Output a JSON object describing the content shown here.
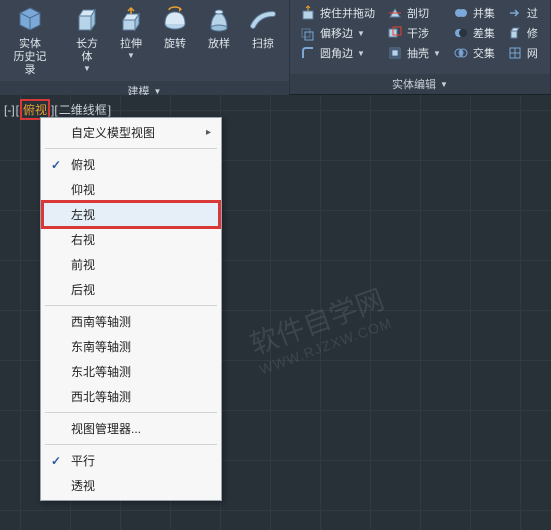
{
  "ribbon": {
    "panel1": {
      "title": "建模",
      "items": {
        "solid_history": "实体\n历史记录",
        "box": "长方体",
        "extrude": "拉伸",
        "revolve": "旋转",
        "loft": "放样",
        "sweep": "扫掠"
      }
    },
    "panel2": {
      "title": "实体编辑",
      "row1": {
        "presspull": "按住并拖动",
        "slice": "剖切",
        "union": "并集",
        "filter": "过"
      },
      "row2": {
        "offset": "偏移边",
        "interfere": "干涉",
        "subtract": "差集",
        "edit": "修"
      },
      "row3": {
        "fillet": "圆角边",
        "shell": "抽壳",
        "intersect": "交集",
        "mesh": "网"
      }
    }
  },
  "viewport": {
    "controls": {
      "prefix": "[-]",
      "view": "俯视",
      "style": "二维线框"
    }
  },
  "menu": {
    "custom_view": "自定义模型视图",
    "top": "俯视",
    "bottom": "仰视",
    "left": "左视",
    "right": "右视",
    "front": "前视",
    "back": "后视",
    "sw_iso": "西南等轴测",
    "se_iso": "东南等轴测",
    "ne_iso": "东北等轴测",
    "nw_iso": "西北等轴测",
    "view_manager": "视图管理器...",
    "parallel": "平行",
    "perspective": "透视"
  },
  "watermark": {
    "main": "软件自学网",
    "sub": "WWW.RJZXW.COM"
  }
}
